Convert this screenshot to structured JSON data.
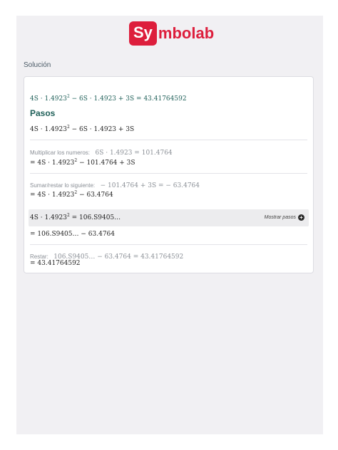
{
  "brand": {
    "logo_box": "Sy",
    "logo_rest": "mbolab"
  },
  "section_label": "Solución",
  "solution": {
    "equation_html": "4S · 1.4923<sup>2</sup> − 6S · 1.4923 + 3S = 43.41764592",
    "pasos_title": "Pasos",
    "start_html": "4S · 1.4923<sup>2</sup> − 6S · 1.4923 + 3S"
  },
  "steps": [
    {
      "hint_label": "Multiplicar los numeros:",
      "hint_math": "6S · 1.4923 = 101.4764",
      "result_html": "= 4S · 1.4923<sup>2</sup> − 101.4764 + 3S"
    },
    {
      "hint_label": "Sumar/restar lo siguiente:",
      "hint_math": "− 101.4764 + 3S = − 63.4764",
      "result_html": "= 4S · 1.4923<sup>2</sup> − 63.4764"
    },
    {
      "substep_html": "4S · 1.4923<sup>2</sup> = 106.S9405…",
      "show_steps_label": "Mostrar pasos",
      "result_html": "= 106.S9405… − 63.4764"
    },
    {
      "hint_label": "Restar:",
      "hint_math": "106.S9405… − 63.4764 = 43.41764592",
      "result_html": "= 43.41764592"
    }
  ],
  "icons": {
    "show_steps": "plus-circle-icon"
  },
  "colors": {
    "brand": "#dd1e3c",
    "teal": "#1d5e57",
    "page_bg": "#f1f0f3"
  }
}
